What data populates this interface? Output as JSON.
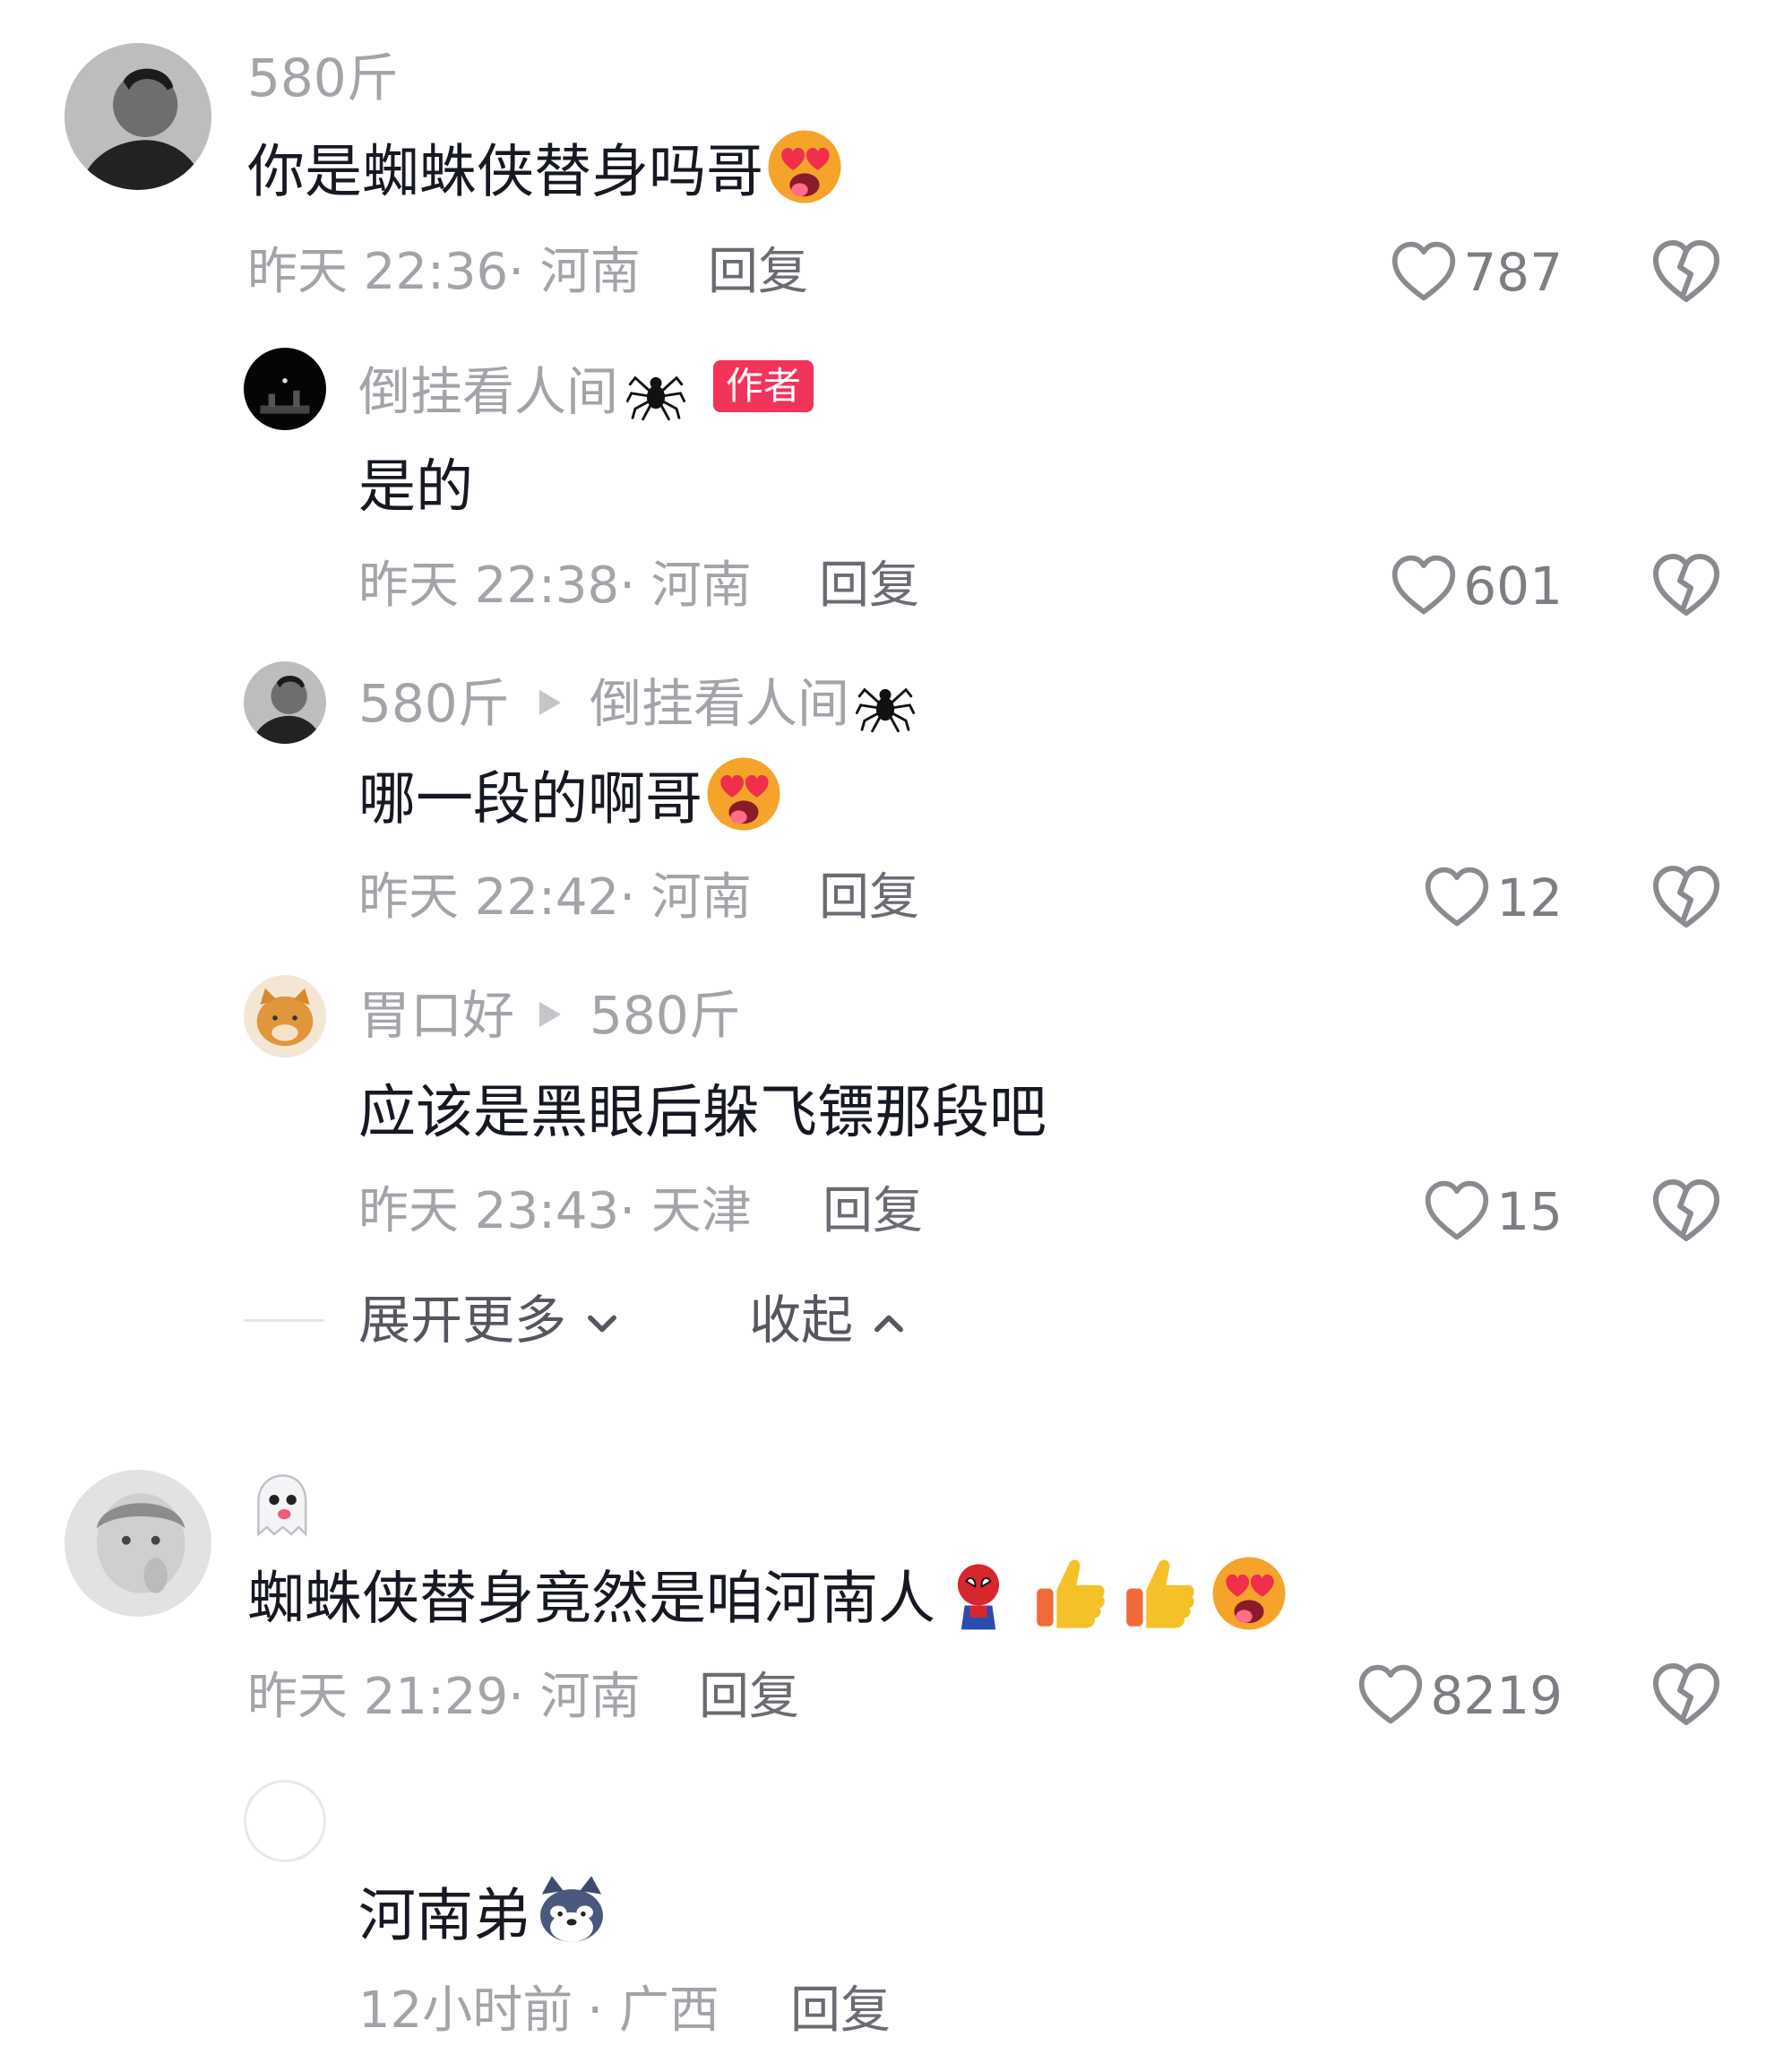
{
  "comments": [
    {
      "user": "580斤",
      "text": "你是蜘蛛侠替身吗哥",
      "time": "昨天 22:36",
      "location": "· 河南",
      "reply": "回复",
      "likes": "787",
      "replies": [
        {
          "user": "倒挂看人间",
          "badge": "作者",
          "text": "是的",
          "time": "昨天 22:38",
          "location": "· 河南",
          "reply": "回复",
          "likes": "601"
        },
        {
          "user": "580斤",
          "reply_to": "倒挂看人间",
          "text": "哪一段的啊哥",
          "time": "昨天 22:42",
          "location": "· 河南",
          "reply": "回复",
          "likes": "12"
        },
        {
          "user": "胃口好",
          "reply_to": "580斤",
          "text": "应该是黑眼后躲飞镖那段吧",
          "time": "昨天 23:43",
          "location": "· 天津",
          "reply": "回复",
          "likes": "15"
        }
      ],
      "expand_more": "展开更多",
      "collapse": "收起"
    },
    {
      "user_icon": "ghost-emoji",
      "text": "蜘蛛侠替身竟然是咱河南人",
      "time": "昨天 21:29",
      "location": "· 河南",
      "reply": "回复",
      "likes": "8219",
      "replies": [
        {
          "text": "河南弟",
          "time": "12小时前",
          "location": "· 广西",
          "reply": "回复"
        }
      ]
    }
  ],
  "colors": {
    "accent": "#f2335a",
    "secondary_text": "#a3a4a9",
    "primary_text": "#161823"
  }
}
